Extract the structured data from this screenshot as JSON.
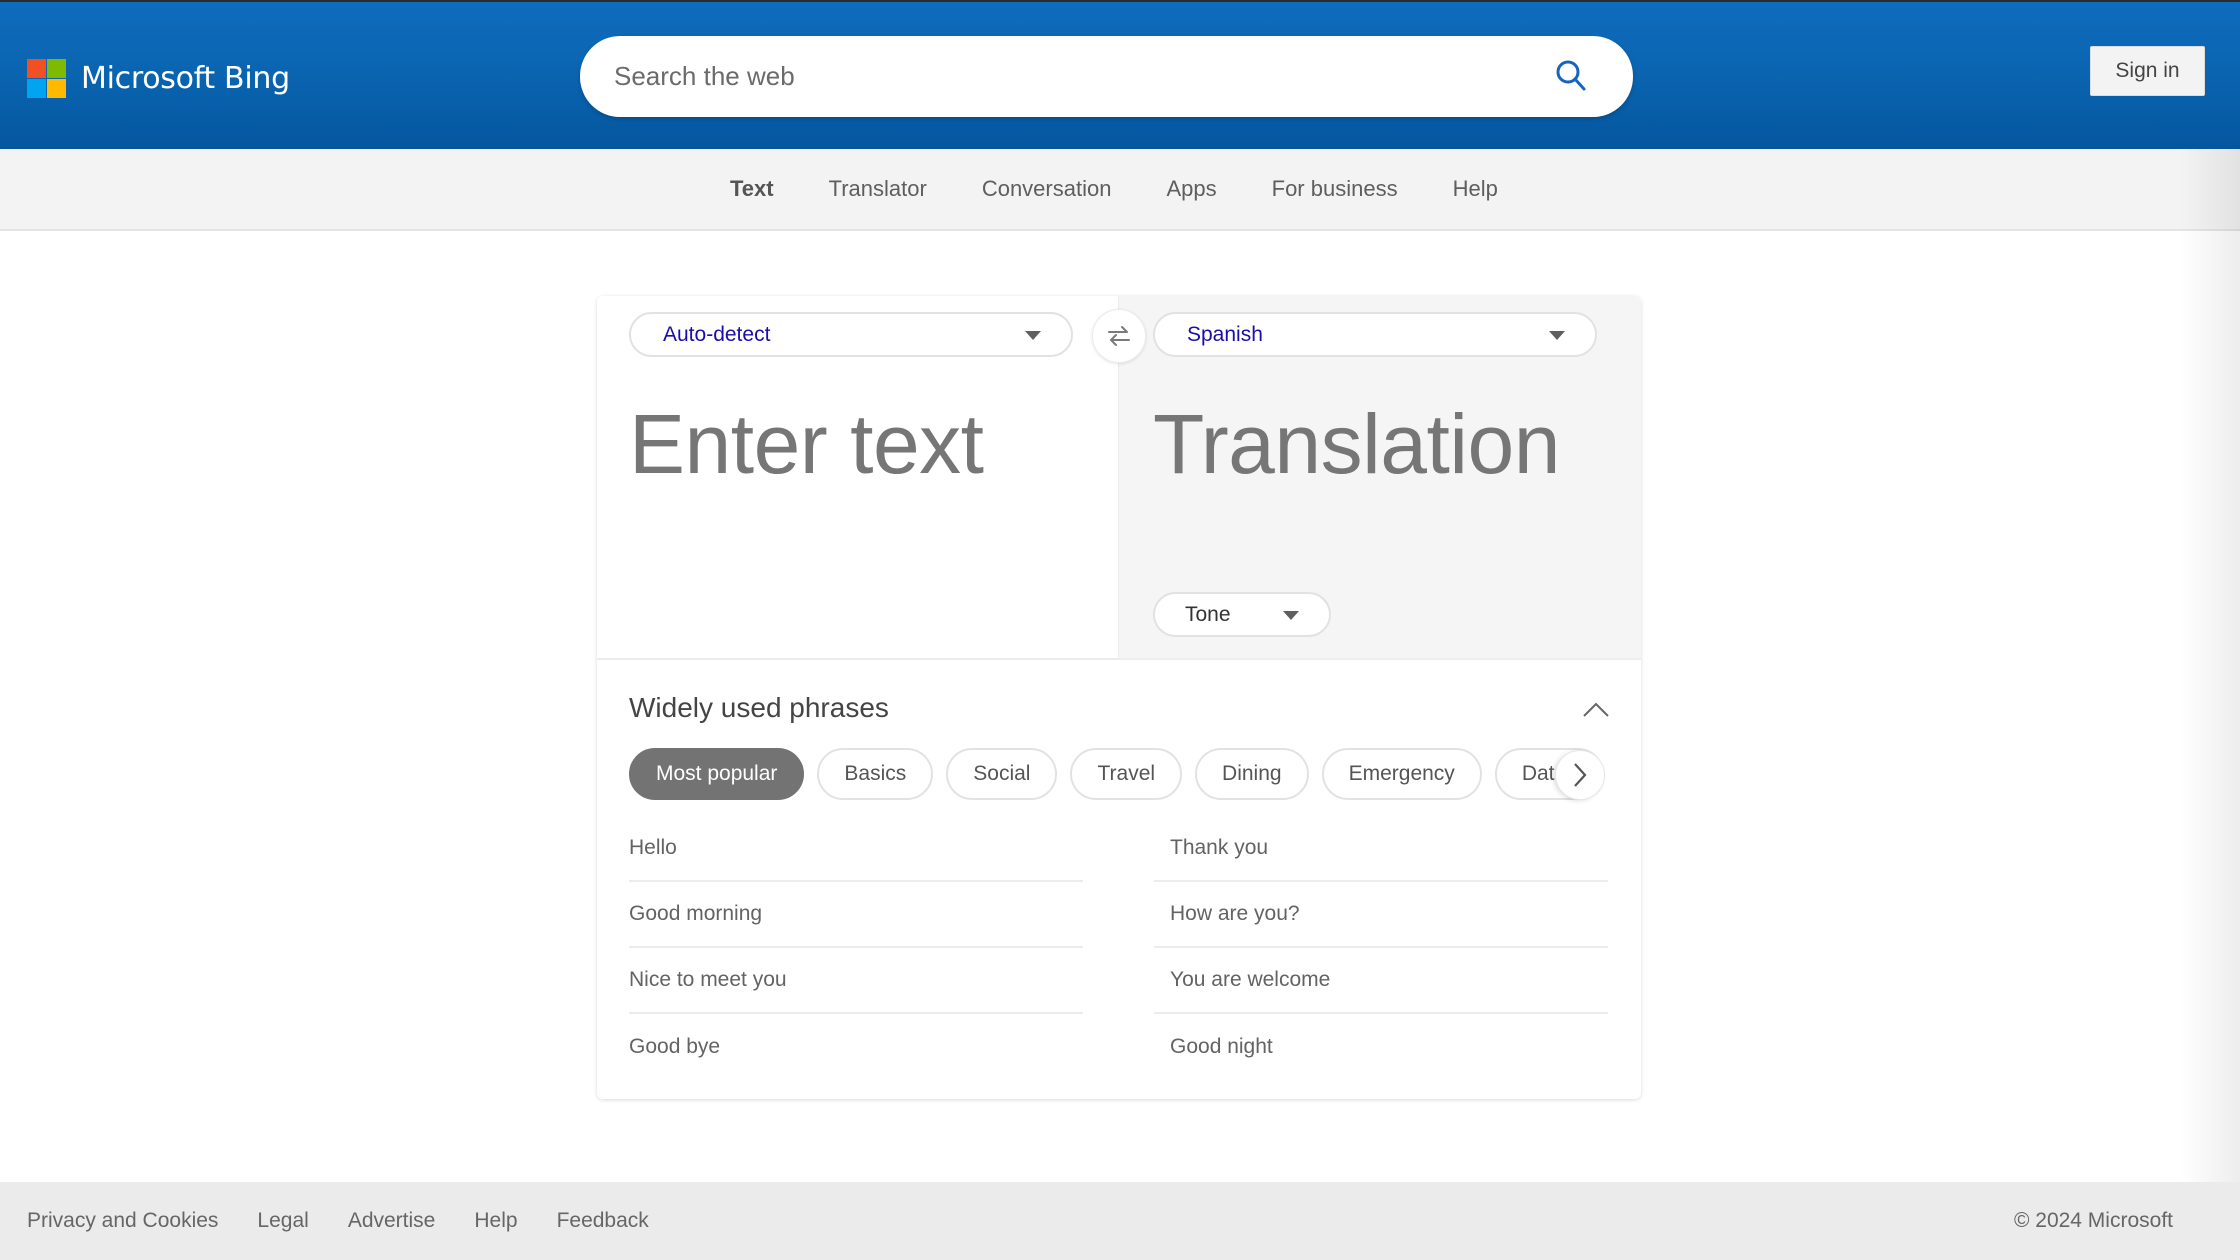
{
  "header": {
    "brand": "Microsoft Bing",
    "search": {
      "placeholder": "Search the web",
      "value": ""
    },
    "sign_in_label": "Sign in"
  },
  "nav": {
    "items": [
      {
        "label": "Text",
        "active": true
      },
      {
        "label": "Translator"
      },
      {
        "label": "Conversation"
      },
      {
        "label": "Apps"
      },
      {
        "label": "For business"
      },
      {
        "label": "Help"
      }
    ]
  },
  "translator": {
    "source_language": "Auto-detect",
    "target_language": "Spanish",
    "input_placeholder": "Enter text",
    "output_placeholder": "Translation",
    "tone_label": "Tone"
  },
  "phrases": {
    "title": "Widely used phrases",
    "categories": [
      {
        "label": "Most popular",
        "active": true
      },
      {
        "label": "Basics"
      },
      {
        "label": "Social"
      },
      {
        "label": "Travel"
      },
      {
        "label": "Dining"
      },
      {
        "label": "Emergency"
      },
      {
        "label": "Dates"
      }
    ],
    "left_column": [
      "Hello",
      "Good morning",
      "Nice to meet you",
      "Good bye"
    ],
    "right_column": [
      "Thank you",
      "How are you?",
      "You are welcome",
      "Good night"
    ]
  },
  "footer": {
    "links": [
      "Privacy and Cookies",
      "Legal",
      "Advertise",
      "Help",
      "Feedback"
    ],
    "copyright": "© 2024 Microsoft"
  },
  "colors": {
    "header_blue": "#0a64b0",
    "language_link": "#1a0dab",
    "active_chip": "#737373"
  }
}
